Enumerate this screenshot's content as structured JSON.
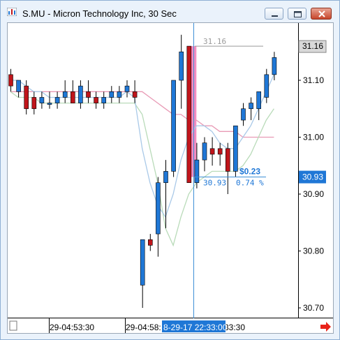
{
  "window": {
    "title": "S.MU - Micron Technology Inc, 30 Sec"
  },
  "price_axis": {
    "labels": [
      "31.10",
      "31.00",
      "30.90",
      "30.80",
      "30.70"
    ],
    "last_price_badge": "31.16",
    "crosshair_price_badge": "30.93"
  },
  "time_axis": {
    "labels": [
      "29-04:53:30",
      "29-04:58:",
      "33:30"
    ],
    "crosshair_time_badge": "8-29-17 22:33:00"
  },
  "annotations": {
    "high_label": "31.16",
    "change_amount": "$0.23",
    "change_from": "30.93",
    "change_percent": "0.74 %"
  },
  "colors": {
    "up_candle": "#1f77d6",
    "down_candle": "#c0151b",
    "highlight_band": "#f48cc0",
    "ma_fast": "#a9c9e8",
    "ma_slow": "#b9dbb9",
    "ma_pink": "#e89ab5",
    "crosshair": "#3d8fd6",
    "scroll_arrow": "#e8231a"
  },
  "chart_data": {
    "type": "candlestick",
    "title": "S.MU - Micron Technology Inc, 30 Sec",
    "ylim": [
      30.68,
      31.22
    ],
    "candles": [
      {
        "o": 31.11,
        "h": 31.12,
        "l": 31.08,
        "c": 31.09
      },
      {
        "o": 31.08,
        "h": 31.1,
        "l": 31.07,
        "c": 31.1
      },
      {
        "o": 31.09,
        "h": 31.1,
        "l": 31.04,
        "c": 31.05
      },
      {
        "o": 31.07,
        "h": 31.08,
        "l": 31.04,
        "c": 31.05
      },
      {
        "o": 31.06,
        "h": 31.08,
        "l": 31.05,
        "c": 31.07
      },
      {
        "o": 31.06,
        "h": 31.08,
        "l": 31.05,
        "c": 31.06
      },
      {
        "o": 31.06,
        "h": 31.08,
        "l": 31.05,
        "c": 31.07
      },
      {
        "o": 31.07,
        "h": 31.1,
        "l": 31.06,
        "c": 31.08
      },
      {
        "o": 31.08,
        "h": 31.1,
        "l": 31.06,
        "c": 31.06
      },
      {
        "o": 31.06,
        "h": 31.1,
        "l": 31.05,
        "c": 31.09
      },
      {
        "o": 31.08,
        "h": 31.1,
        "l": 31.06,
        "c": 31.07
      },
      {
        "o": 31.07,
        "h": 31.08,
        "l": 31.05,
        "c": 31.06
      },
      {
        "o": 31.06,
        "h": 31.08,
        "l": 31.05,
        "c": 31.07
      },
      {
        "o": 31.07,
        "h": 31.09,
        "l": 31.06,
        "c": 31.08
      },
      {
        "o": 31.07,
        "h": 31.09,
        "l": 31.06,
        "c": 31.08
      },
      {
        "o": 31.08,
        "h": 31.1,
        "l": 31.07,
        "c": 31.09
      },
      {
        "o": 31.08,
        "h": 31.1,
        "l": 31.06,
        "c": 31.07
      },
      {
        "o": 30.74,
        "h": 30.82,
        "l": 30.7,
        "c": 30.82
      },
      {
        "o": 30.82,
        "h": 30.83,
        "l": 30.8,
        "c": 30.81
      },
      {
        "o": 30.83,
        "h": 30.93,
        "l": 30.79,
        "c": 30.92
      },
      {
        "o": 30.92,
        "h": 30.96,
        "l": 30.84,
        "c": 30.94
      },
      {
        "o": 30.94,
        "h": 31.1,
        "l": 30.93,
        "c": 31.1
      },
      {
        "o": 31.1,
        "h": 31.18,
        "l": 31.05,
        "c": 31.15
      },
      {
        "o": 31.16,
        "h": 31.16,
        "l": 30.92,
        "c": 30.92
      },
      {
        "o": 30.92,
        "h": 30.99,
        "l": 30.91,
        "c": 30.96
      },
      {
        "o": 30.96,
        "h": 31.0,
        "l": 30.94,
        "c": 30.99
      },
      {
        "o": 30.98,
        "h": 31.0,
        "l": 30.95,
        "c": 30.97
      },
      {
        "o": 30.98,
        "h": 30.99,
        "l": 30.95,
        "c": 30.97
      },
      {
        "o": 30.98,
        "h": 30.99,
        "l": 30.9,
        "c": 30.94
      },
      {
        "o": 30.94,
        "h": 31.02,
        "l": 30.93,
        "c": 31.02
      },
      {
        "o": 31.03,
        "h": 31.06,
        "l": 31.02,
        "c": 31.05
      },
      {
        "o": 31.05,
        "h": 31.07,
        "l": 31.03,
        "c": 31.06
      },
      {
        "o": 31.05,
        "h": 31.08,
        "l": 31.03,
        "c": 31.08
      },
      {
        "o": 31.07,
        "h": 31.12,
        "l": 31.06,
        "c": 31.11
      },
      {
        "o": 31.11,
        "h": 31.15,
        "l": 31.1,
        "c": 31.14
      }
    ],
    "ma_fast": [
      31.1,
      31.1,
      31.09,
      31.08,
      31.08,
      31.07,
      31.07,
      31.07,
      31.07,
      31.07,
      31.07,
      31.07,
      31.07,
      31.07,
      31.07,
      31.08,
      31.07,
      30.98,
      30.92,
      30.88,
      30.86,
      30.9,
      30.96,
      31.0,
      31.02,
      31.02,
      31.01,
      30.99,
      30.98,
      30.98,
      31.0,
      31.02,
      31.05,
      31.08,
      31.11
    ],
    "ma_slow": [
      31.08,
      31.07,
      31.07,
      31.07,
      31.06,
      31.06,
      31.06,
      31.06,
      31.06,
      31.06,
      31.06,
      31.06,
      31.06,
      31.06,
      31.06,
      31.06,
      31.06,
      31.04,
      30.98,
      30.92,
      30.84,
      30.81,
      30.86,
      30.9,
      30.92,
      30.93,
      30.94,
      30.94,
      30.94,
      30.94,
      30.95,
      30.97,
      31.0,
      31.03,
      31.05
    ],
    "ma_pink": [
      31.08,
      31.08,
      31.08,
      31.08,
      31.08,
      31.08,
      31.08,
      31.08,
      31.08,
      31.08,
      31.08,
      31.08,
      31.08,
      31.08,
      31.08,
      31.08,
      31.08,
      31.08,
      31.07,
      31.06,
      31.05,
      31.04,
      31.04,
      31.03,
      31.03,
      31.02,
      31.02,
      31.01,
      31.01,
      31.01,
      31.0,
      31.0,
      31.0,
      31.0,
      31.0
    ],
    "high_line_value": 31.16,
    "crosshair_value": 30.93
  }
}
